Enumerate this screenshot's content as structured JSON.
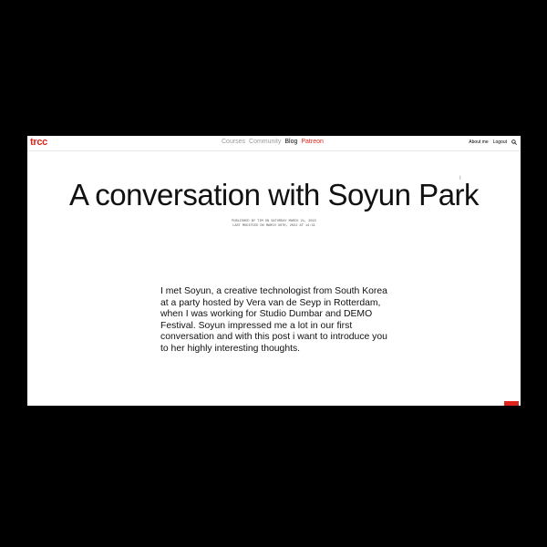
{
  "colors": {
    "accent": "#e0251c",
    "nav_inactive": "#9a9a9a",
    "nav_active": "#111111",
    "background": "#ffffff",
    "frame": "#000000"
  },
  "nav": {
    "logo": "trcc",
    "items": [
      {
        "label": "Courses",
        "state": "inactive"
      },
      {
        "label": "Community",
        "state": "inactive"
      },
      {
        "label": "Blog",
        "state": "active"
      },
      {
        "label": "Patreon",
        "state": "accent"
      }
    ],
    "right": {
      "about": "About me",
      "logout": "Logout",
      "search_icon": "search-icon"
    }
  },
  "article": {
    "title": "A conversation with Soyun Park",
    "published": "PUBLISHED BY TIM ON SATURDAY MARCH 21, 2022",
    "modified": "LAST MODIFIED ON MARCH 30TH, 2022 AT 14:31",
    "intro": "I met Soyun, a creative technologist from South Korea at a party hosted by Vera van de Seyp in Rotterdam, when I was working for Studio Dumbar and DEMO Festival. Soyun impressed me a lot in our first conversation and with this post i want to introduce you to her highly interesting thoughts."
  }
}
